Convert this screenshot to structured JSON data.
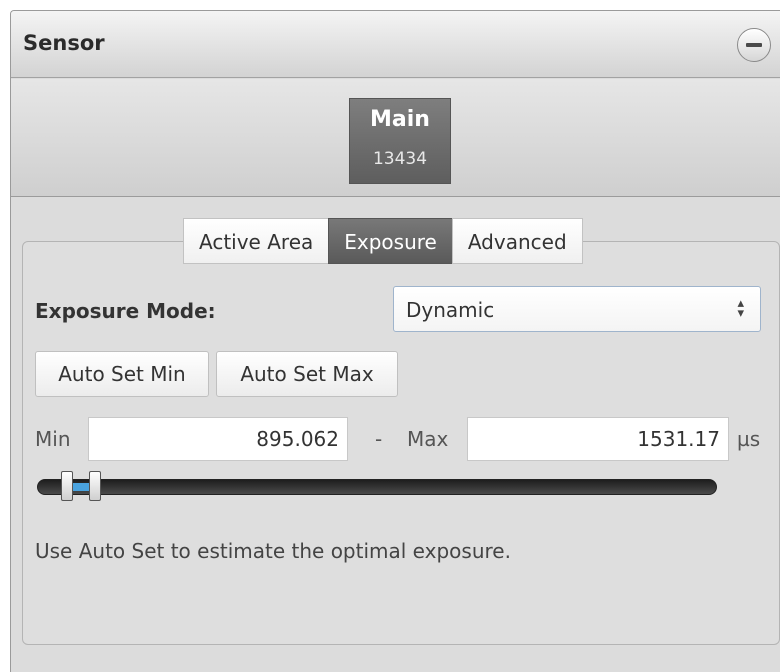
{
  "header": {
    "title": "Sensor"
  },
  "camera": {
    "name": "Main",
    "serial": "13434"
  },
  "tabs": [
    {
      "label": "Active Area",
      "active": false
    },
    {
      "label": "Exposure",
      "active": true
    },
    {
      "label": "Advanced",
      "active": false
    }
  ],
  "exposure": {
    "mode_label": "Exposure Mode:",
    "mode_value": "Dynamic",
    "auto_min_label": "Auto Set Min",
    "auto_max_label": "Auto Set Max",
    "min_label": "Min",
    "min_value": "895.062",
    "separator": "-",
    "max_label": "Max",
    "max_value": "1531.17",
    "unit": "µs",
    "hint": "Use Auto Set to estimate the optimal exposure."
  },
  "colors": {
    "accent": "#4aa3df",
    "active_tab": "#666666",
    "panel_bg": "#dcdcdc"
  },
  "icons": {
    "collapse": "minus-circle-icon",
    "select_arrow": "up-down-arrows-icon"
  }
}
